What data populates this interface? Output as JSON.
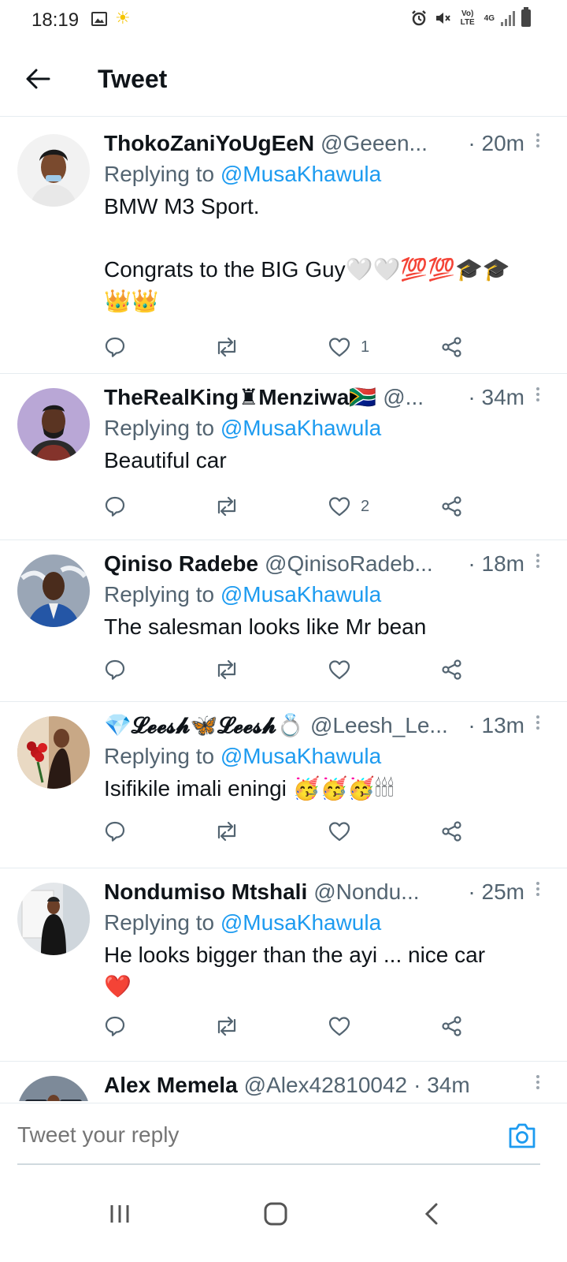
{
  "status_bar": {
    "time": "18:19",
    "network_top": "Vo) LTE",
    "network_4g": "4G",
    "icons": [
      "gallery-icon",
      "sun-icon",
      "alarm-icon",
      "mute-icon",
      "volte-icon",
      "4g-icon",
      "signal-icon",
      "battery-icon"
    ]
  },
  "header": {
    "title": "Tweet"
  },
  "tweets": [
    {
      "name": "ThokoZaniYoUgEeN",
      "handle": "@Geeen...",
      "time": "· 20m",
      "replying_prefix": "Replying to ",
      "replying_to": "@MusaKhawula",
      "text": "BMW M3 Sport.\n\nCongrats to the BIG Guy🤍🤍💯💯🎓🎓\n👑👑",
      "likes": "1"
    },
    {
      "name": "TheRealKing♜Menziwa🇿🇦",
      "handle": "@...",
      "time": "· 34m",
      "replying_prefix": "Replying to ",
      "replying_to": "@MusaKhawula",
      "text": "Beautiful car",
      "likes": "2"
    },
    {
      "name": "Qiniso Radebe",
      "handle": "@QinisoRadeb...",
      "time": "· 18m",
      "replying_prefix": "Replying to ",
      "replying_to": "@MusaKhawula",
      "text": "The salesman looks like Mr bean",
      "likes": ""
    },
    {
      "name": "💎𝓛𝓮𝓮𝓼𝓱🦋𝓛𝓮𝓮𝓼𝓱💍",
      "handle": "@Leesh_Le...",
      "time": "· 13m",
      "replying_prefix": "Replying to ",
      "replying_to": "@MusaKhawula",
      "text": "Isifikile imali eningi 🥳🥳🥳🕯🕯🕯",
      "likes": ""
    },
    {
      "name": "Nondumiso Mtshali",
      "handle": "@Nondu...",
      "time": "· 25m",
      "replying_prefix": "Replying to ",
      "replying_to": "@MusaKhawula",
      "text": "He looks bigger than the ayi ... nice car\n❤️",
      "likes": ""
    },
    {
      "name": "Alex Memela",
      "handle": "@Alex42810042",
      "time": "· 34m",
      "replying_prefix": "",
      "replying_to": "",
      "text": "",
      "likes": ""
    }
  ],
  "reply_bar": {
    "placeholder": "Tweet your reply"
  },
  "colors": {
    "accent": "#1d9bf0",
    "secondary_text": "#536471",
    "divider": "#e6ecf0"
  }
}
